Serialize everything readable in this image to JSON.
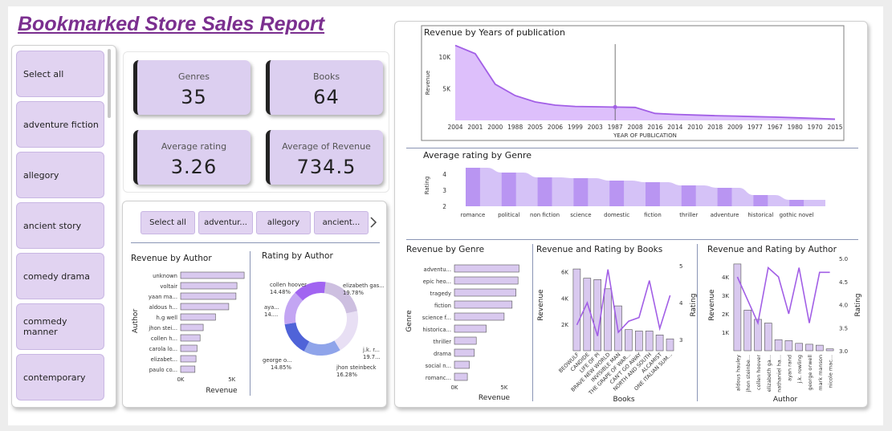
{
  "report_title": "Bookmarked Store Sales Report",
  "slicer": {
    "items": [
      "Select all",
      "adventure fiction",
      "allegory",
      "ancient story",
      "comedy drama",
      "commedy manner",
      "contemporary"
    ]
  },
  "kpis": [
    {
      "label": "Genres",
      "value": "35"
    },
    {
      "label": "Books",
      "value": "64"
    },
    {
      "label": "Average rating",
      "value": "3.26"
    },
    {
      "label": "Average of Revenue",
      "value": "734.5"
    }
  ],
  "tiles": {
    "items": [
      "Select all",
      "adventur...",
      "allegory",
      "ancient..."
    ],
    "next_icon": "chevron-right-icon"
  },
  "colors": {
    "accent": "#b48bea",
    "area": "#d9b8fb",
    "line": "#a25fe6",
    "bar": "#d9c9ef",
    "bar_stroke": "#555555",
    "title": "#7b2f8f"
  },
  "chart_data": [
    {
      "type": "area",
      "title": "Revenue by Years of publication",
      "xlabel": "YEAR OF PUBLICATION",
      "ylabel": "Revenue",
      "categories": [
        "2004",
        "2001",
        "2000",
        "1988",
        "2005",
        "2006",
        "1999",
        "2003",
        "1987",
        "2008",
        "2016",
        "2014",
        "2010",
        "2018",
        "2009",
        "1977",
        "1967",
        "1980",
        "1970",
        "2015"
      ],
      "values": [
        11800,
        10500,
        5700,
        3900,
        2900,
        2400,
        2200,
        2150,
        2100,
        2050,
        1100,
        950,
        850,
        750,
        680,
        600,
        520,
        420,
        320,
        200
      ],
      "yticks": [
        {
          "v": 5000,
          "label": "5K"
        },
        {
          "v": 10000,
          "label": "10K"
        }
      ],
      "ylim": [
        0,
        12000
      ],
      "grid": false
    },
    {
      "type": "area",
      "title": "Average rating by Genre",
      "ylabel": "Rating",
      "categories": [
        "romance novel",
        "political satire",
        "non fiction",
        "science fiction",
        "domestic fiction",
        "fiction",
        "thriller",
        "adventure fiction",
        "historical fiction",
        "gothic novel"
      ],
      "category_labels": [
        "romance",
        "political",
        "non fiction",
        "science",
        "domestic",
        "fiction",
        "thriller",
        "adventure",
        "historical",
        "gothic novel"
      ],
      "values": [
        4.4,
        4.1,
        3.8,
        3.75,
        3.6,
        3.5,
        3.3,
        3.15,
        2.7,
        2.4
      ],
      "yticks": [
        {
          "v": 2,
          "label": "2"
        },
        {
          "v": 3,
          "label": "3"
        },
        {
          "v": 4,
          "label": "4"
        }
      ],
      "ylim": [
        2,
        4.6
      ]
    },
    {
      "type": "bar",
      "title": "Revenue by Author",
      "xlabel": "Revenue",
      "ylabel": "Author",
      "categories": [
        "unknown",
        "voltair",
        "yaan ma...",
        "aldous h...",
        "h.g well",
        "jhon stei...",
        "collen h...",
        "carola lo...",
        "elizabet...",
        "paulo co..."
      ],
      "values": [
        6200,
        5500,
        5400,
        4700,
        3400,
        2200,
        1900,
        1600,
        1500,
        1400
      ],
      "xticks": [
        {
          "v": 0,
          "label": "0K"
        },
        {
          "v": 5000,
          "label": "5K"
        }
      ],
      "xlim": [
        0,
        8000
      ]
    },
    {
      "type": "pie",
      "title": "Rating by Author",
      "slices": [
        {
          "name": "elizabeth gas...",
          "pct": "19.78%",
          "value": 19.78,
          "color": "#cdbfe0"
        },
        {
          "name": "j.k. r...",
          "pct": "19.7...",
          "value": 19.7,
          "color": "#e8dff4"
        },
        {
          "name": "jhon steinbeck",
          "pct": "16.28%",
          "value": 16.28,
          "color": "#8fa4ea"
        },
        {
          "name": "george o...",
          "pct": "14.85%",
          "value": 14.85,
          "color": "#4f63d8"
        },
        {
          "name": "aya...",
          "pct": "14....",
          "value": 14.9,
          "color": "#c3a5f3"
        },
        {
          "name": "collen hoover",
          "pct": "14.48%",
          "value": 14.48,
          "color": "#a164f1"
        }
      ]
    },
    {
      "type": "bar",
      "title": "Revenue by Genre",
      "xlabel": "Revenue",
      "ylabel": "Genre",
      "categories": [
        "adventu...",
        "epic heo...",
        "tragedy",
        "fiction",
        "science f...",
        "historica...",
        "thriller",
        "drama",
        "social n...",
        "romanc..."
      ],
      "values": [
        6500,
        6400,
        6200,
        5800,
        5000,
        3200,
        2200,
        2000,
        1500,
        1300
      ],
      "xticks": [
        {
          "v": 0,
          "label": "0K"
        },
        {
          "v": 5000,
          "label": "5K"
        }
      ],
      "xlim": [
        0,
        8000
      ]
    },
    {
      "type": "bar",
      "title": "Revenue and Rating by Books",
      "xlabel": "Books",
      "ylabel": "Revenue",
      "y2label": "Rating",
      "categories": [
        "BEOWULF",
        "CANDIDE",
        "LIFE OF PI",
        "BRAVE NEW WORLD",
        "INVISIBLE MAN",
        "THE GRAPE OF WAR...",
        "CAN'T GO AWAY",
        "NORTH AND SOUTH",
        "ALCAMIST",
        "ONE ITALIAN SUM..."
      ],
      "series": [
        {
          "name": "Revenue",
          "values": [
            6200,
            5500,
            5400,
            4700,
            3400,
            1600,
            1500,
            1500,
            1200,
            900
          ]
        },
        {
          "name": "Rating",
          "values": [
            3.4,
            4.0,
            3.1,
            4.9,
            3.2,
            3.5,
            3.6,
            4.6,
            3.3,
            4.2
          ]
        }
      ],
      "yticks": [
        {
          "v": 2000,
          "label": "2K"
        },
        {
          "v": 4000,
          "label": "4K"
        },
        {
          "v": 6000,
          "label": "6K"
        }
      ],
      "ylim": [
        0,
        7000
      ],
      "y2ticks": [
        {
          "v": 3,
          "label": "3"
        },
        {
          "v": 4,
          "label": "4"
        },
        {
          "v": 5,
          "label": "5"
        }
      ],
      "y2lim": [
        2.7,
        5.2
      ]
    },
    {
      "type": "bar",
      "title": "Revenue and Rating by Author",
      "xlabel": "Author",
      "ylabel": "Revenue",
      "y2label": "Rating",
      "categories": [
        "aldous hauley",
        "jhon steinbe...",
        "collen hoover",
        "elizabeth ga...",
        "nathaniel ha...",
        "ayan rand",
        "j.k. rowling",
        "george orwell",
        "mark manson",
        "nicole mac..."
      ],
      "series": [
        {
          "name": "Revenue",
          "values": [
            4700,
            2200,
            1700,
            1500,
            600,
            550,
            400,
            350,
            300,
            100
          ]
        },
        {
          "name": "Rating",
          "values": [
            4.6,
            4.1,
            3.6,
            4.8,
            4.6,
            3.8,
            4.8,
            3.6,
            4.7,
            4.7
          ]
        }
      ],
      "yticks": [
        {
          "v": 1000,
          "label": "1K"
        },
        {
          "v": 2000,
          "label": "2K"
        },
        {
          "v": 3000,
          "label": "3K"
        },
        {
          "v": 4000,
          "label": "4K"
        }
      ],
      "ylim": [
        0,
        5000
      ],
      "y2ticks": [
        {
          "v": 3.0,
          "label": "3.0"
        },
        {
          "v": 3.5,
          "label": "3.5"
        },
        {
          "v": 4.0,
          "label": "4.0"
        },
        {
          "v": 4.5,
          "label": "4.5"
        },
        {
          "v": 5.0,
          "label": "5.0"
        }
      ],
      "y2lim": [
        3.0,
        5.0
      ]
    }
  ]
}
